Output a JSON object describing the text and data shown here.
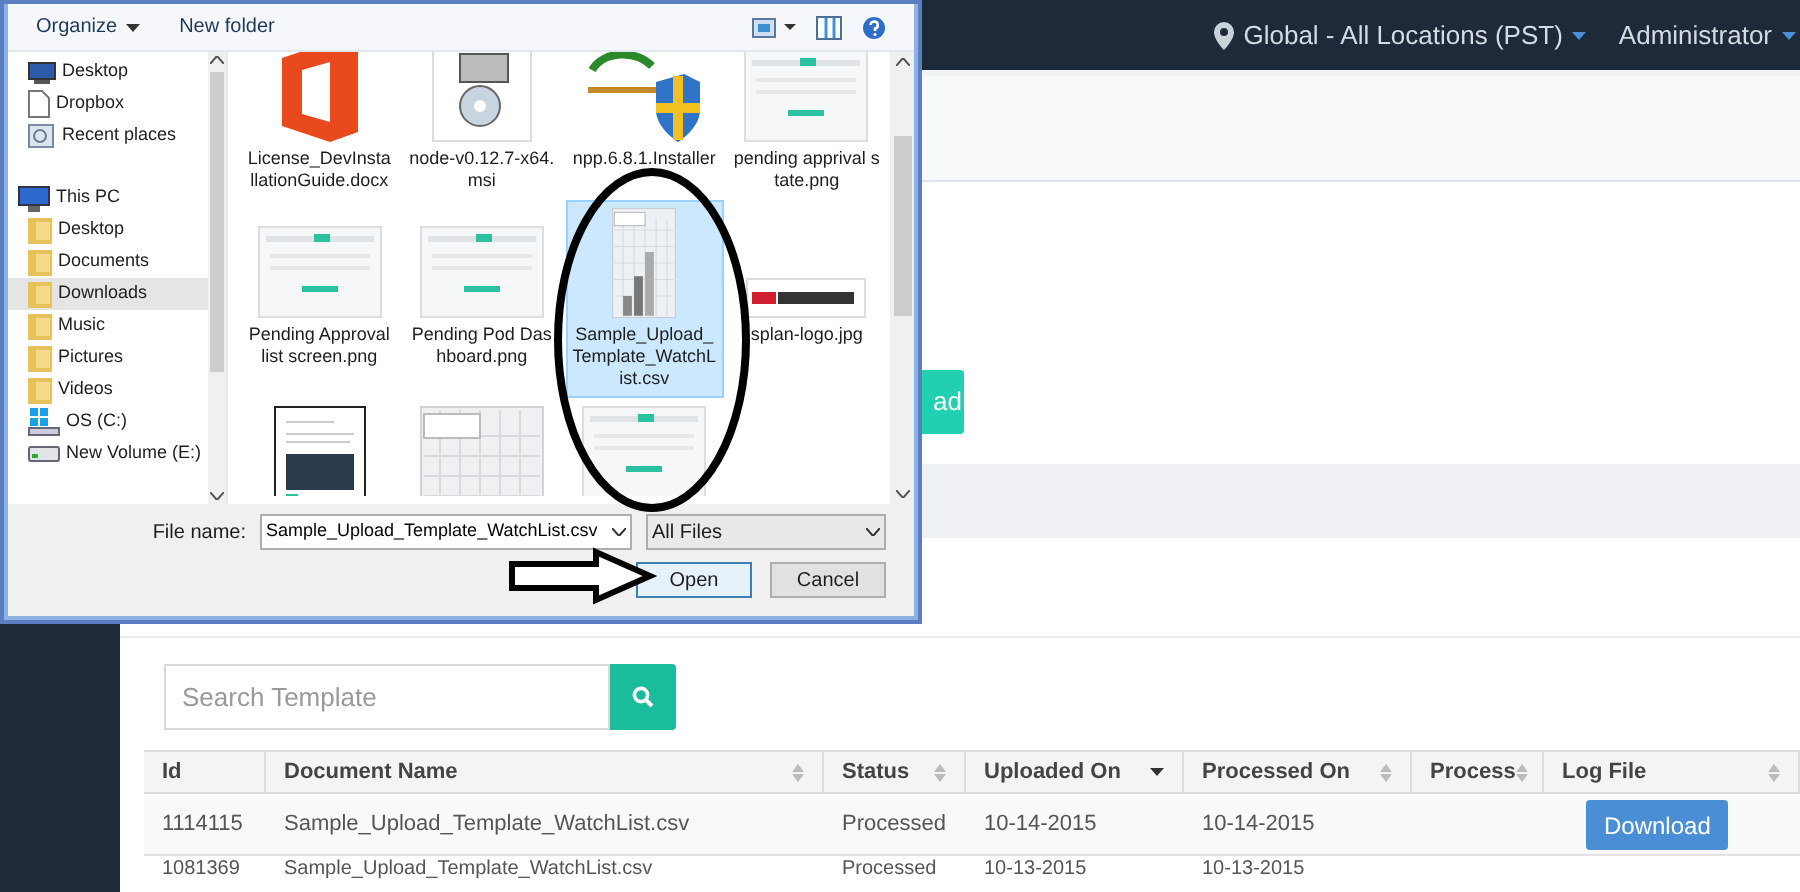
{
  "navbar": {
    "location": "Global - All Locations (PST)",
    "user": "Administrator"
  },
  "upload_button": {
    "label": "ad"
  },
  "search": {
    "placeholder": "Search Template"
  },
  "table": {
    "columns": [
      {
        "label": "Id",
        "kind": "plain"
      },
      {
        "label": "Document Name",
        "kind": "sortable"
      },
      {
        "label": "Status",
        "kind": "sortable"
      },
      {
        "label": "Uploaded On",
        "kind": "sorted"
      },
      {
        "label": "Processed On",
        "kind": "sortable"
      },
      {
        "label": "Process",
        "kind": "sortable"
      },
      {
        "label": "Log File",
        "kind": "sortable"
      }
    ],
    "rows": [
      {
        "cells": [
          "1114115",
          "Sample_Upload_Template_WatchList.csv",
          "Processed",
          "10-14-2015",
          "10-14-2015",
          ""
        ],
        "action": "Download"
      },
      {
        "cells": [
          "1081369",
          "Sample_Upload_Template_WatchList.csv",
          "Processed",
          "10-13-2015",
          "10-13-2015",
          ""
        ]
      }
    ]
  },
  "dialog": {
    "toolbar": [
      "Organize",
      "New folder"
    ],
    "nav": [
      {
        "label": "Desktop",
        "kind": "desktop",
        "selected": false
      },
      {
        "label": "Dropbox",
        "kind": "file",
        "selected": false
      },
      {
        "label": "Recent places",
        "kind": "recent",
        "selected": false
      },
      {
        "label": "This PC",
        "kind": "pc",
        "selected": false,
        "children": [
          {
            "label": "Desktop",
            "kind": "folder",
            "selected": false
          },
          {
            "label": "Documents",
            "kind": "folder",
            "selected": false
          },
          {
            "label": "Downloads",
            "kind": "folder",
            "selected": true
          },
          {
            "label": "Music",
            "kind": "folder",
            "selected": false
          },
          {
            "label": "Pictures",
            "kind": "folder",
            "selected": false
          },
          {
            "label": "Videos",
            "kind": "folder",
            "selected": false
          },
          {
            "label": "OS (C:)",
            "kind": "drive",
            "selected": false
          },
          {
            "label": "New Volume (E:)",
            "kind": "usb",
            "selected": false
          }
        ]
      }
    ],
    "files": [
      {
        "name": "License_DevInstallationGuide.docx",
        "kind": "office",
        "selected": false
      },
      {
        "name": "node-v0.12.7-x64.msi",
        "kind": "installer",
        "selected": false
      },
      {
        "name": "npp.6.8.1.Installer",
        "kind": "shield",
        "selected": false
      },
      {
        "name": "pending apprival state.png",
        "kind": "screenshot",
        "selected": false
      },
      {
        "name": "Pending Approval list screen.png",
        "kind": "screenshot",
        "selected": false
      },
      {
        "name": "Pending Pod Dashboard.png",
        "kind": "screenshot",
        "selected": false
      },
      {
        "name": "Sample_Upload_Template_WatchList.csv",
        "kind": "chart",
        "selected": true
      },
      {
        "name": "splan-logo.jpg",
        "kind": "logo",
        "selected": false
      },
      {
        "kind": "document",
        "selected": false
      },
      {
        "kind": "grid",
        "selected": false
      },
      {
        "kind": "screenshot",
        "selected": false
      }
    ],
    "file_name": "Sample_Upload_Template_WatchList.csv",
    "file_name_label": "File name:",
    "filter": "All Files",
    "buttons": [
      "Open",
      "Cancel"
    ]
  }
}
